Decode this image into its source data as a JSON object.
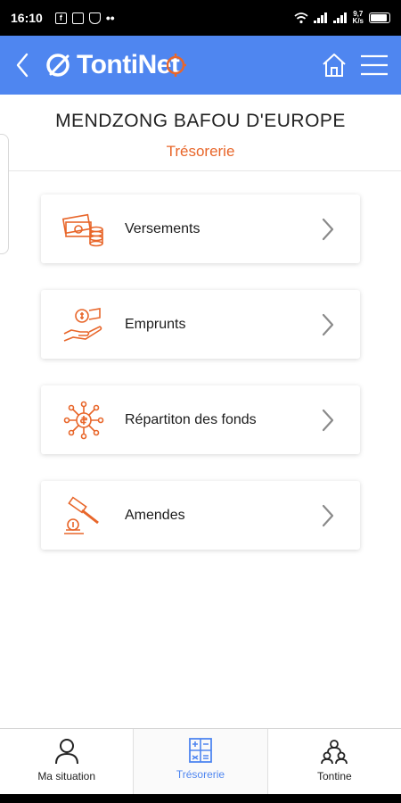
{
  "status_bar": {
    "time": "16:10",
    "net_speed_value": "9,7",
    "net_speed_unit": "K/s"
  },
  "header": {
    "app_name": "TontiNet",
    "brand_color": "#4f86f0"
  },
  "page": {
    "org_name": "MENDZONG BAFOU D'EUROPE",
    "section_title": "Trésorerie",
    "accent_color": "#e8662a"
  },
  "menu": {
    "items": [
      {
        "label": "Versements",
        "icon": "cash-coins-icon"
      },
      {
        "label": "Emprunts",
        "icon": "hand-money-icon"
      },
      {
        "label": "Répartiton des fonds",
        "icon": "fund-distribution-icon"
      },
      {
        "label": "Amendes",
        "icon": "gavel-coin-icon"
      }
    ]
  },
  "bottom_nav": {
    "items": [
      {
        "label": "Ma situation",
        "icon": "user-icon",
        "active": false
      },
      {
        "label": "Trésorerie",
        "icon": "calculator-icon",
        "active": true
      },
      {
        "label": "Tontine",
        "icon": "group-icon",
        "active": false
      }
    ]
  }
}
